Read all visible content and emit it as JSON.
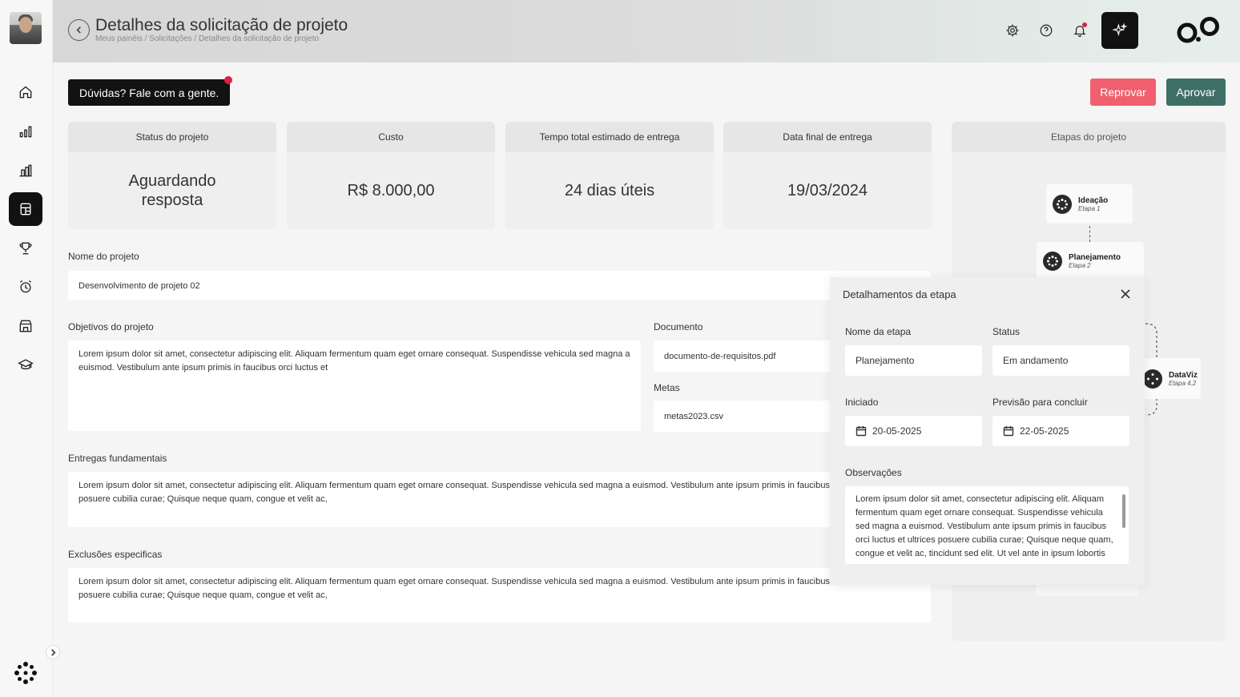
{
  "header": {
    "title": "Detalhes da solicitação de projeto",
    "breadcrumb": "Meus painéis / Solicitações / Detalhes da solicitação de projeto"
  },
  "sidebar": {
    "items": [
      {
        "name": "home-icon"
      },
      {
        "name": "bar-chart-icon"
      },
      {
        "name": "buildings-chart-icon"
      },
      {
        "name": "layout-icon",
        "active": true
      },
      {
        "name": "trophy-icon"
      },
      {
        "name": "alarm-clock-icon"
      },
      {
        "name": "store-icon"
      },
      {
        "name": "graduation-cap-icon"
      }
    ]
  },
  "actions": {
    "help_label": "Dúvidas? Fale com a gente.",
    "reject_label": "Reprovar",
    "approve_label": "Aprovar"
  },
  "stats": [
    {
      "label": "Status do projeto",
      "value": "Aguardando resposta"
    },
    {
      "label": "Custo",
      "value": "R$ 8.000,00"
    },
    {
      "label": "Tempo total estimado de entrega",
      "value": "24 dias úteis"
    },
    {
      "label": "Data final de entrega",
      "value": "19/03/2024"
    }
  ],
  "form": {
    "project_name_label": "Nome do projeto",
    "project_name_value": "Desenvolvimento de projeto 02",
    "objectives_label": "Objetivos do projeto",
    "objectives_value": "Lorem ipsum dolor sit amet, consectetur adipiscing elit. Aliquam fermentum quam eget ornare consequat. Suspendisse vehicula sed magna a euismod. Vestibulum ante ipsum primis in faucibus orci luctus et",
    "document_label": "Documento",
    "document_value": "documento-de-requisitos.pdf",
    "goals_label": "Metas",
    "goals_value": "metas2023.csv",
    "deliveries_label": "Entregas fundamentais",
    "deliveries_value": "Lorem ipsum dolor sit amet, consectetur adipiscing elit. Aliquam fermentum quam eget ornare consequat. Suspendisse vehicula sed magna a euismod. Vestibulum ante ipsum primis in faucibus orci luctus et ultrices posuere cubilia curae; Quisque neque quam, congue et velit ac,",
    "exclusions_label": "Exclusões especificas",
    "exclusions_value": "Lorem ipsum dolor sit amet, consectetur adipiscing elit. Aliquam fermentum quam eget ornare consequat. Suspendisse vehicula sed magna a euismod. Vestibulum ante ipsum primis in faucibus orci luctus et ultrices posuere cubilia curae; Quisque neque quam, congue et velit ac,"
  },
  "stages": {
    "title": "Etapas do projeto",
    "nodes": [
      {
        "name": "Ideação",
        "step": "Etapa 1"
      },
      {
        "name": "Planejamento",
        "step": "Etapa 2"
      },
      {
        "name": "DataViz",
        "step": "Etapa 4.2"
      }
    ]
  },
  "modal": {
    "title": "Detalhamentos da etapa",
    "stage_name_label": "Nome da etapa",
    "stage_name_value": "Planejamento",
    "status_label": "Status",
    "status_value": "Em andamento",
    "started_label": "Iniciado",
    "started_value": "20-05-2025",
    "forecast_label": "Previsão para concluir",
    "forecast_value": "22-05-2025",
    "notes_label": "Observações",
    "notes_value": "Lorem ipsum dolor sit amet, consectetur adipiscing elit. Aliquam fermentum quam eget ornare consequat. Suspendisse vehicula sed magna a euismod. Vestibulum ante ipsum primis in faucibus orci luctus et ultrices posuere cubilia curae; Quisque neque quam, congue et velit ac, tincidunt sed elit. Ut vel ante in ipsum lobortis"
  },
  "colors": {
    "reject": "#f0606f",
    "approve": "#3d6f66",
    "notification": "#e11d48"
  }
}
